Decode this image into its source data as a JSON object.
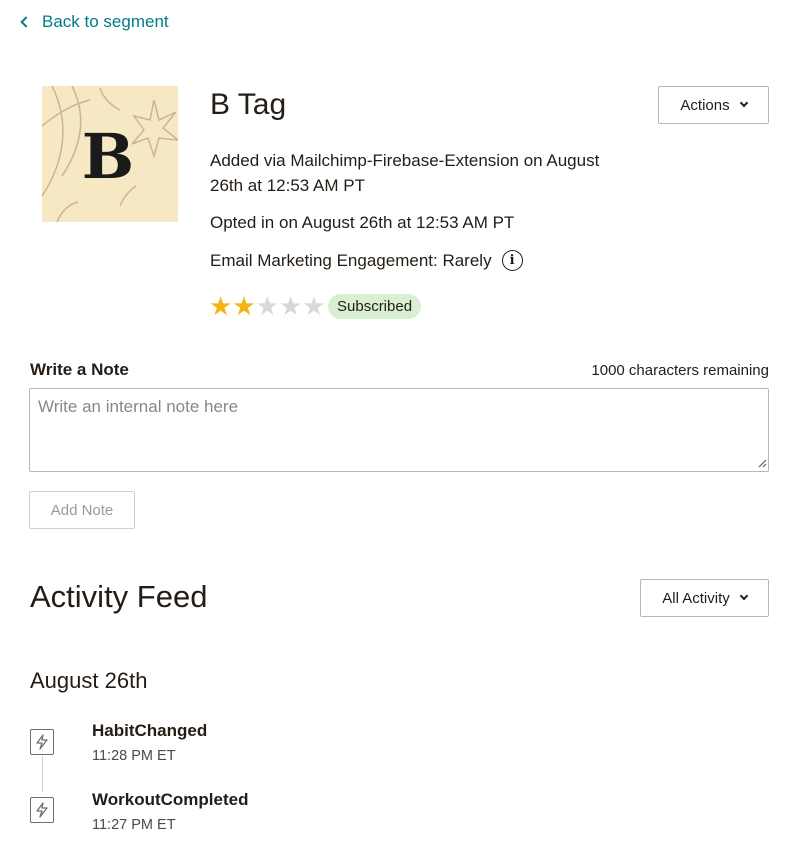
{
  "nav": {
    "back_label": "Back to segment"
  },
  "contact": {
    "avatar_letter": "B",
    "name": "B Tag",
    "added_text": "Added via Mailchimp-Firebase-Extension on August 26th at 12:53 AM PT",
    "opted_text": "Opted in on August 26th at 12:53 AM PT",
    "engagement_text": "Email Marketing Engagement: Rarely",
    "info_glyph": "i",
    "rating": {
      "value": 2,
      "max": 5
    },
    "status": "Subscribed",
    "actions_label": "Actions"
  },
  "note": {
    "label": "Write a Note",
    "remaining": "1000 characters remaining",
    "placeholder": "Write an internal note here",
    "value": "",
    "add_label": "Add Note"
  },
  "feed": {
    "title": "Activity Feed",
    "filter_label": "All Activity",
    "date": "August 26th",
    "events": [
      {
        "title": "HabitChanged",
        "time": "11:28 PM ET",
        "icon": "lightning-icon"
      },
      {
        "title": "WorkoutCompleted",
        "time": "11:27 PM ET",
        "icon": "lightning-icon"
      }
    ]
  },
  "colors": {
    "link": "#007c89",
    "star_on": "#f5b316",
    "star_off": "#d8d8d8",
    "badge_bg": "#d8efd4",
    "avatar_bg": "#f6e8c3"
  }
}
